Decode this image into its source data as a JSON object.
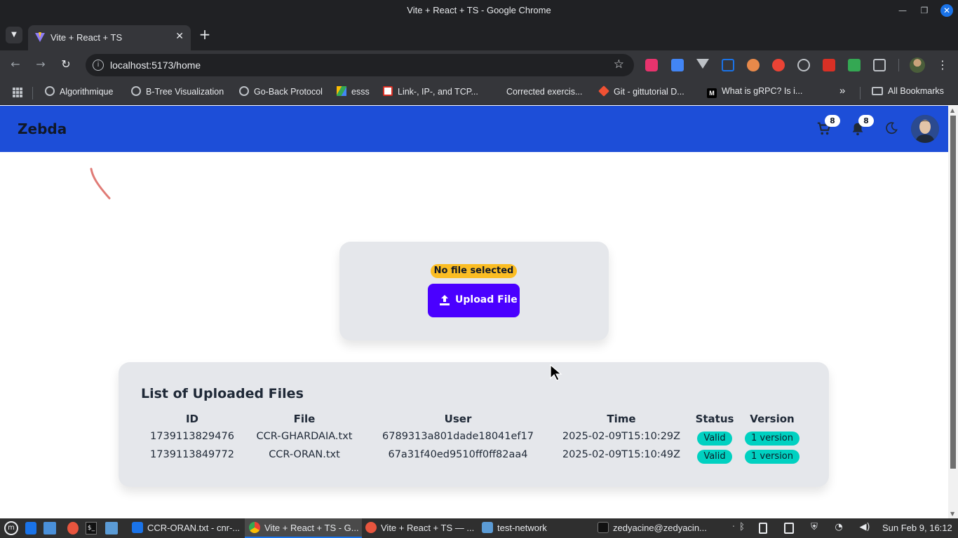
{
  "window": {
    "title": "Vite + React + TS - Google Chrome"
  },
  "browser": {
    "tab_title": "Vite + React + TS",
    "url": "localhost:5173/home",
    "bookmarks": [
      {
        "label": "Algorithmique",
        "icon": "globe-icon"
      },
      {
        "label": "B-Tree Visualization",
        "icon": "globe-icon"
      },
      {
        "label": "Go-Back Protocol",
        "icon": "globe-icon"
      },
      {
        "label": "esss",
        "icon": "google-drive-icon"
      },
      {
        "label": "Link-, IP-, and TCP...",
        "icon": "slides-icon"
      },
      {
        "label": "Corrected exercis...",
        "icon": "blank-icon"
      },
      {
        "label": "Git - gittutorial D...",
        "icon": "git-icon"
      },
      {
        "label": "What is gRPC? Is i...",
        "icon": "medium-icon"
      }
    ],
    "all_bookmarks_label": "All Bookmarks"
  },
  "app": {
    "brand": "Zebda",
    "cart_count": "8",
    "notification_count": "8",
    "upload": {
      "status": "No file selected",
      "button_label": "Upload File"
    },
    "files": {
      "title": "List of Uploaded Files",
      "columns": [
        "ID",
        "File",
        "User",
        "Time",
        "Status",
        "Version"
      ],
      "rows": [
        {
          "id": "1739113829476",
          "file": "CCR-GHARDAIA.txt",
          "user": "6789313a801dade18041ef17",
          "time": "2025-02-09T15:10:29Z",
          "status": "Valid",
          "version": "1 version"
        },
        {
          "id": "1739113849772",
          "file": "CCR-ORAN.txt",
          "user": "67a31f40ed9510ff0ff82aa4",
          "time": "2025-02-09T15:10:49Z",
          "status": "Valid",
          "version": "1 version"
        }
      ]
    },
    "colors": {
      "navbar": "#1d4ed8",
      "upload_button": "#4a00ff",
      "warning_badge": "#fbbd23",
      "status_pill": "#00d1c1"
    }
  },
  "taskbar": {
    "items": [
      {
        "label": "CCR-ORAN.txt - cnr-...",
        "icon": "vscode-icon"
      },
      {
        "label": "Vite + React + TS - G...",
        "icon": "chrome-icon"
      },
      {
        "label": "Vite + React + TS — ...",
        "icon": "firefox-icon"
      },
      {
        "label": "test-network",
        "icon": "folder-icon"
      },
      {
        "label": "zedyacine@zedyacin...",
        "icon": "terminal-icon"
      }
    ],
    "clock": "Sun Feb  9, 16:12"
  }
}
